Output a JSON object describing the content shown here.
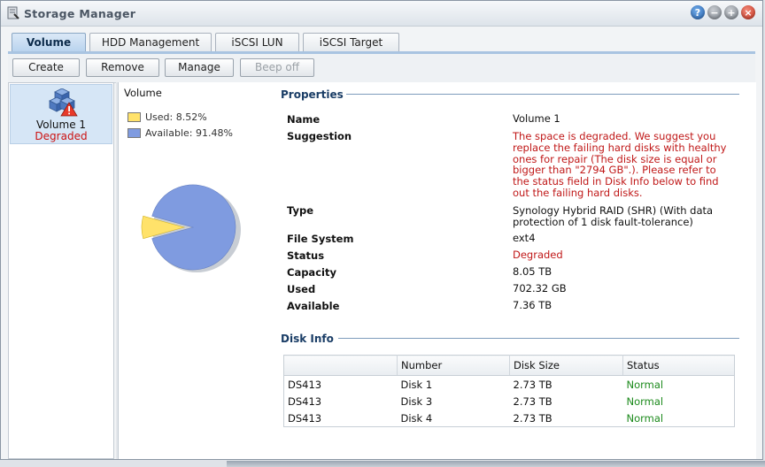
{
  "window": {
    "title": "Storage Manager"
  },
  "tabs": [
    {
      "label": "Volume",
      "active": true
    },
    {
      "label": "HDD Management",
      "active": false
    },
    {
      "label": "iSCSI LUN",
      "active": false
    },
    {
      "label": "iSCSI Target",
      "active": false
    }
  ],
  "toolbar": {
    "create": "Create",
    "remove": "Remove",
    "manage": "Manage",
    "beep_off": "Beep off"
  },
  "volume_list": [
    {
      "name": "Volume 1",
      "state": "Degraded"
    }
  ],
  "usage": {
    "label": "Volume",
    "used_label": "Used: 8.52%",
    "available_label": "Available: 91.48%",
    "used_fraction": 0.0852,
    "used_color": "#ffe26a",
    "available_color": "#7f9be0"
  },
  "properties": {
    "heading": "Properties",
    "rows": [
      {
        "label": "Name",
        "value": "Volume 1",
        "red": false
      },
      {
        "label": "Suggestion",
        "value": "The space is degraded. We suggest you replace the failing hard disks with healthy ones for repair (The disk size is equal or bigger than \"2794 GB\".). Please refer to the status field in Disk Info below to find out the failing hard disks.",
        "red": true
      },
      {
        "label": "Type",
        "value": "Synology Hybrid RAID (SHR) (With data protection of 1 disk fault-tolerance)",
        "red": false
      },
      {
        "label": "File System",
        "value": "ext4",
        "red": false
      },
      {
        "label": "Status",
        "value": "Degraded",
        "red": true
      },
      {
        "label": "Capacity",
        "value": "8.05 TB",
        "red": false
      },
      {
        "label": "Used",
        "value": "702.32 GB",
        "red": false
      },
      {
        "label": "Available",
        "value": "7.36 TB",
        "red": false
      }
    ]
  },
  "disk_info": {
    "heading": "Disk Info",
    "columns": [
      "",
      "Number",
      "Disk Size",
      "Status"
    ],
    "rows": [
      [
        "DS413",
        "Disk 1",
        "2.73 TB",
        "Normal"
      ],
      [
        "DS413",
        "Disk 3",
        "2.73 TB",
        "Normal"
      ],
      [
        "DS413",
        "Disk 4",
        "2.73 TB",
        "Normal"
      ]
    ]
  }
}
